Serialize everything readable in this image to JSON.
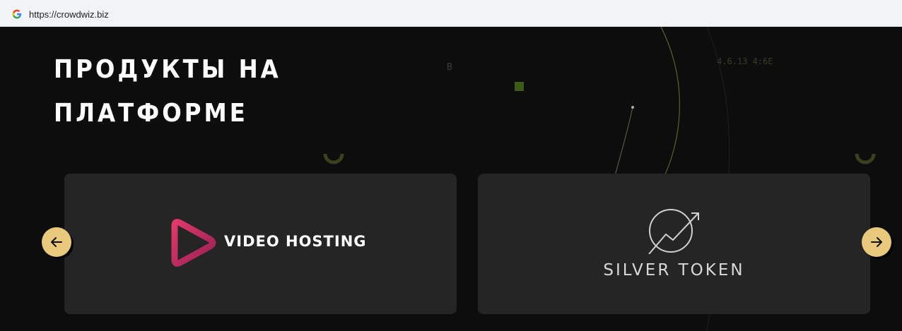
{
  "browser": {
    "url": "https://crowdwiz.biz",
    "favicon": "google-g-icon"
  },
  "page": {
    "title_line1": "ПРОДУКТЫ НА",
    "title_line2": "ПЛАТФОРМЕ",
    "decor_hex": "4.6.13 4:6E",
    "decor_b": "B"
  },
  "carousel": {
    "prev_icon": "arrow-left-icon",
    "next_icon": "arrow-right-icon",
    "accent_color": "#e9c97c",
    "cards": [
      {
        "label": "VIDEO HOSTING",
        "icon": "play-icon",
        "color": "#c92a6a"
      },
      {
        "label": "SILVER TOKEN",
        "icon": "trend-arrow-circle-icon",
        "color": "#d8d8d8"
      }
    ]
  }
}
